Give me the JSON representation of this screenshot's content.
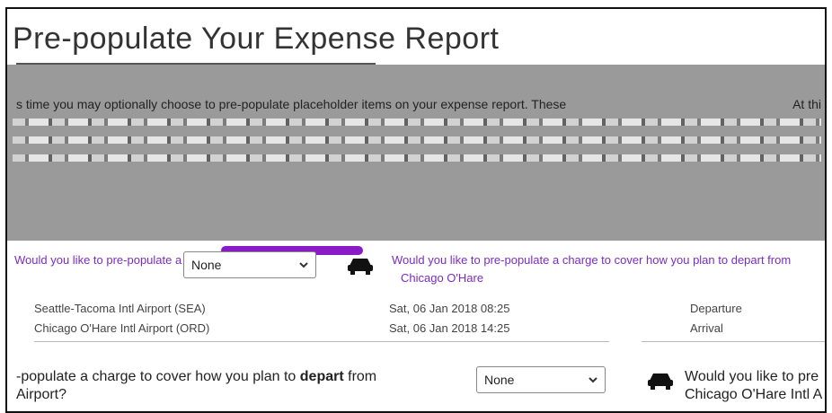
{
  "header": {
    "title": "Pre-populate Your Expense Report",
    "intro_lead": "s time you may optionally choose to pre-populate placeholder items on your expense report. These",
    "intro_tail": "At thi"
  },
  "prompt_row": {
    "left_text": "Would you like to pre-populate a charge",
    "right_text": "Would you like to pre-populate a charge to cover how you plan to depart from",
    "right_sub": "Chicago O'Hare"
  },
  "first_select": {
    "value": "None"
  },
  "flights": [
    {
      "from": "Seattle-Tacoma Intl Airport (SEA)",
      "date": "Sat, 06 Jan 2018 08:25",
      "type": "Departure"
    },
    {
      "from": "Chicago O'Hare Intl Airport (ORD)",
      "date": "Sat, 06 Jan 2018 14:25",
      "type": "Arrival"
    }
  ],
  "bottom_question": {
    "part1": "-populate a charge to cover how you plan to ",
    "bold": "depart",
    "part2": " from",
    "line2": "Airport?"
  },
  "second_select": {
    "value": "None"
  },
  "right_question": {
    "line1": "Would you like to pre",
    "line2": "Chicago O'Hare Intl A"
  },
  "colors": {
    "accent": "#8a1cc7",
    "band": "#9a9a9a"
  },
  "icons": [
    "car-icon",
    "chevron-down-icon"
  ]
}
